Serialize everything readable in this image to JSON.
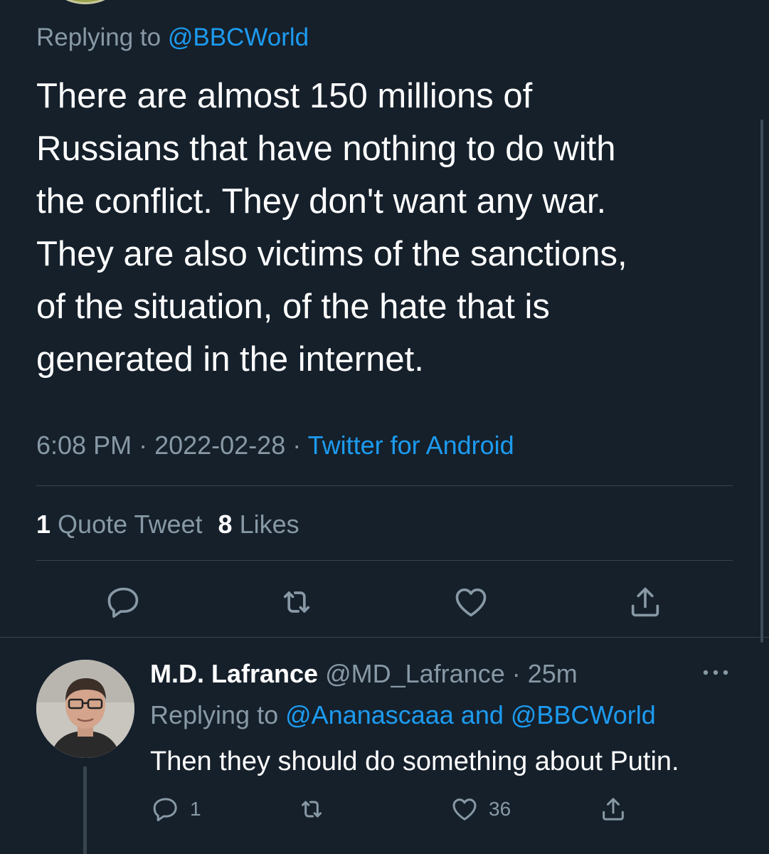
{
  "tweet": {
    "replying_prefix": "Replying to ",
    "replying_handle": "@BBCWorld",
    "text_lines": [
      "There are almost 150 millions of",
      "Russians that have nothing to do with",
      "the conflict. They don't want any war.",
      "They are also victims of the sanctions,",
      "of the situation, of the hate that is",
      "generated in the internet."
    ],
    "time": "6:08 PM",
    "date": "2022-02-28",
    "separator": " · ",
    "source": "Twitter for Android",
    "quote_count": "1",
    "quote_label": "Quote Tweet",
    "like_count": "8",
    "like_label": "Likes"
  },
  "reply": {
    "name": "M.D. Lafrance",
    "handle": "@MD_Lafrance",
    "time_sep": " · ",
    "time": "25m",
    "replying_prefix": "Replying to ",
    "replying_handles": "@Ananascaaa and @BBCWorld",
    "text": "Then they should do something about Putin.",
    "reply_count": "1",
    "like_count": "36"
  },
  "icons": {
    "reply": "reply-icon",
    "retweet": "retweet-icon",
    "like": "heart-icon",
    "share": "share-icon",
    "more": "more-icon"
  },
  "colors": {
    "background": "#15202b",
    "link": "#1d9bf0",
    "secondary_text": "#8899a6",
    "divider": "#38444d"
  }
}
